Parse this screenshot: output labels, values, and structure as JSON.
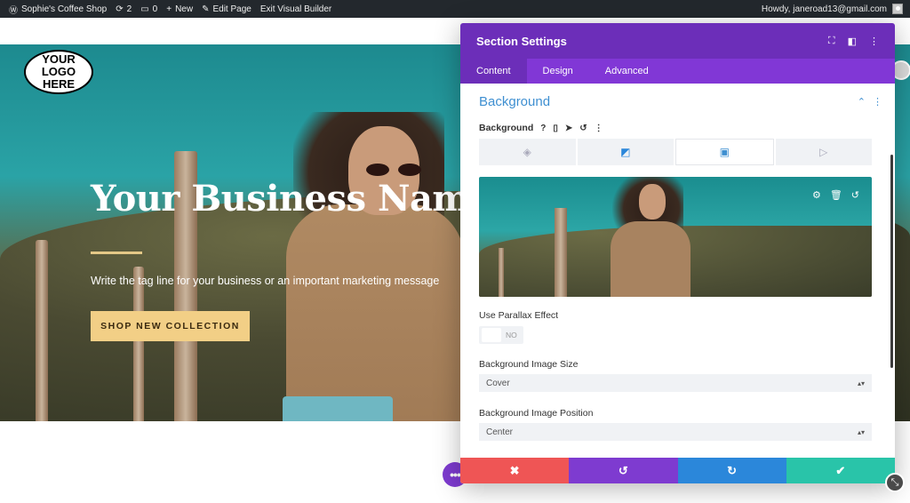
{
  "admin_bar": {
    "site_name": "Sophie's Coffee Shop",
    "updates_count": "2",
    "comments_count": "0",
    "new_label": "New",
    "edit_page_label": "Edit Page",
    "exit_builder_label": "Exit Visual Builder",
    "howdy": "Howdy, janeroad13@gmail.com"
  },
  "hero": {
    "logo_line1": "YOUR",
    "logo_line2": "LOGO HERE",
    "title": "Your Business Name I",
    "tagline": "Write the tag line for your business or an important marketing message",
    "cta": "SHOP NEW COLLECTION"
  },
  "modal": {
    "title": "Section Settings",
    "tabs": [
      "Content",
      "Design",
      "Advanced"
    ],
    "active_tab": "Content",
    "section_title": "Background",
    "background_label": "Background",
    "parallax_label": "Use Parallax Effect",
    "parallax_value": "NO",
    "image_size_label": "Background Image Size",
    "image_size_value": "Cover",
    "image_position_label": "Background Image Position",
    "image_position_value": "Center"
  },
  "icons": {
    "wp_logo": "wordpress-icon",
    "updates": "refresh-icon",
    "comments": "comment-icon",
    "new": "plus-icon",
    "edit": "pencil-icon",
    "more": "ellipsis-icon"
  },
  "colors": {
    "admin_bar": "#23282d",
    "modal_header": "#6c2eb9",
    "modal_tabs": "#8137d6",
    "accent_blue": "#3e8fd1",
    "cancel": "#ef5555",
    "undo": "#7e3bd0",
    "redo": "#2b87da",
    "save": "#29c4a9",
    "cta": "#f2cf86"
  }
}
